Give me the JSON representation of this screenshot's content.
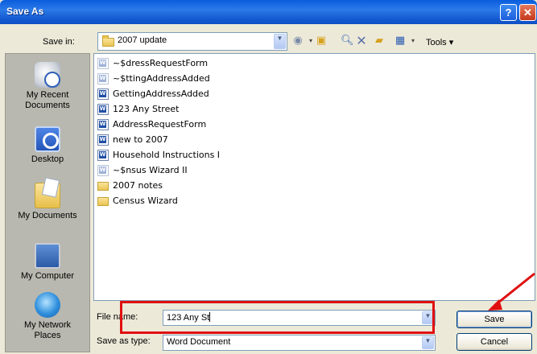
{
  "window": {
    "title": "Save As"
  },
  "header": {
    "save_in_label": "Save in:",
    "save_in_value": "2007 update",
    "tools_label": "Tools"
  },
  "places": [
    {
      "label": "My Recent\nDocuments",
      "icon": "recent-documents-icon"
    },
    {
      "label": "Desktop",
      "icon": "desktop-icon"
    },
    {
      "label": "My Documents",
      "icon": "my-documents-icon"
    },
    {
      "label": "My Computer",
      "icon": "my-computer-icon"
    },
    {
      "label": "My Network\nPlaces",
      "icon": "network-places-icon"
    }
  ],
  "files": [
    {
      "name": "~$dressRequestForm",
      "type": "word-temp"
    },
    {
      "name": "~$ttingAddressAdded",
      "type": "word-temp"
    },
    {
      "name": "GettingAddressAdded",
      "type": "word"
    },
    {
      "name": "123 Any Street",
      "type": "word"
    },
    {
      "name": "AddressRequestForm",
      "type": "word"
    },
    {
      "name": "new to 2007",
      "type": "word"
    },
    {
      "name": "Household Instructions I",
      "type": "word"
    },
    {
      "name": "~$nsus Wizard II",
      "type": "word-temp"
    },
    {
      "name": "2007 notes",
      "type": "folder"
    },
    {
      "name": "Census Wizard",
      "type": "folder"
    }
  ],
  "footer": {
    "file_name_label": "File name:",
    "file_name_value": "123 Any St",
    "save_as_type_label": "Save as type:",
    "save_as_type_value": "Word Document",
    "save_label": "Save",
    "cancel_label": "Cancel"
  },
  "colors": {
    "title_bar": "#0a5ddc",
    "dialog_bg": "#ece9d8",
    "annotation_red": "#e01010"
  }
}
